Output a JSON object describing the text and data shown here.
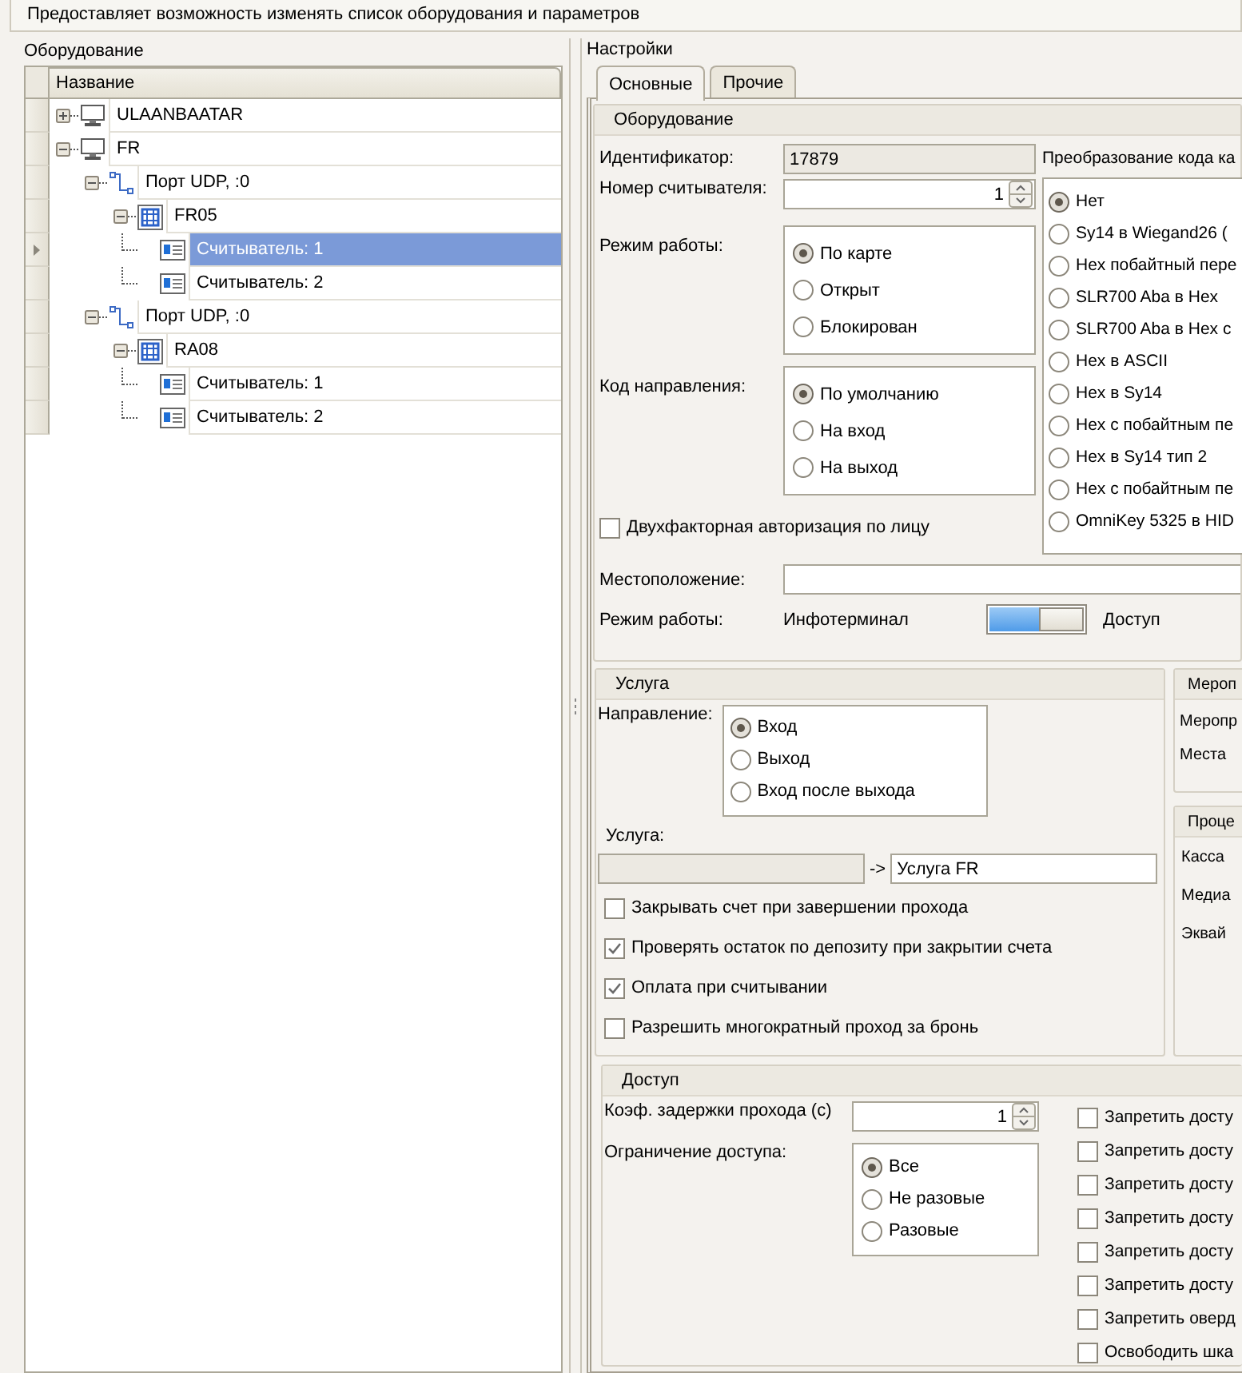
{
  "description": "Предоставляет возможность изменять список оборудования и параметров",
  "equipment": {
    "title": "Оборудование",
    "column": "Название",
    "tree": [
      {
        "label": "ULAANBAATAR",
        "kind": "computer",
        "expanded": false,
        "selected": false
      },
      {
        "label": "FR",
        "kind": "computer",
        "expanded": true,
        "selected": false,
        "children": [
          {
            "label": "Порт UDP, :0",
            "kind": "port",
            "expanded": true,
            "selected": false,
            "children": [
              {
                "label": "FR05",
                "kind": "controller",
                "expanded": true,
                "selected": false,
                "children": [
                  {
                    "label": "Считыватель: 1",
                    "kind": "reader",
                    "selected": true
                  },
                  {
                    "label": "Считыватель: 2",
                    "kind": "reader",
                    "selected": false
                  }
                ]
              }
            ]
          },
          {
            "label": "Порт UDP, :0",
            "kind": "port",
            "expanded": true,
            "selected": false,
            "children": [
              {
                "label": "RA08",
                "kind": "controller",
                "expanded": true,
                "selected": false,
                "children": [
                  {
                    "label": "Считыватель: 1",
                    "kind": "reader",
                    "selected": false
                  },
                  {
                    "label": "Считыватель: 2",
                    "kind": "reader",
                    "selected": false
                  }
                ]
              }
            ]
          }
        ]
      }
    ]
  },
  "settings": {
    "title": "Настройки",
    "tabs": [
      {
        "label": "Основные",
        "selected": true
      },
      {
        "label": "Прочие",
        "selected": false
      }
    ],
    "hardware": {
      "title": "Оборудование",
      "id_label": "Идентификатор:",
      "id_value": "17879",
      "reader_label": "Номер считывателя:",
      "reader_value": "1",
      "work_mode": {
        "label": "Режим работы:",
        "options": [
          {
            "label": "По карте",
            "selected": true
          },
          {
            "label": "Открыт",
            "selected": false
          },
          {
            "label": "Блокирован",
            "selected": false
          }
        ]
      },
      "direction_code": {
        "label": "Код направления:",
        "options": [
          {
            "label": "По умолчанию",
            "selected": true
          },
          {
            "label": "На вход",
            "selected": false
          },
          {
            "label": "На выход",
            "selected": false
          }
        ]
      },
      "two_factor": {
        "label": "Двухфакторная авторизация по лицу",
        "checked": false
      },
      "location_label": "Местоположение:",
      "mode": {
        "label": "Режим работы:",
        "left": "Инфотерминал",
        "right": "Доступ",
        "on": true
      },
      "code_conversion": {
        "title": "Преобразование кода ка",
        "options": [
          {
            "label": "Нет",
            "selected": true
          },
          {
            "label": "Sy14 в Wiegand26 (",
            "selected": false
          },
          {
            "label": "Hex побайтный пере",
            "selected": false
          },
          {
            "label": "SLR700 Aba в Hex",
            "selected": false
          },
          {
            "label": "SLR700 Aba в Hex с",
            "selected": false
          },
          {
            "label": "Hex в ASCII",
            "selected": false
          },
          {
            "label": "Hex в Sy14",
            "selected": false
          },
          {
            "label": "Hex с побайтным пе",
            "selected": false
          },
          {
            "label": "Hex в Sy14 тип 2",
            "selected": false
          },
          {
            "label": "Hex с побайтным пе",
            "selected": false
          },
          {
            "label": "OmniKey 5325 в HID",
            "selected": false
          }
        ]
      }
    },
    "service": {
      "title": "Услуга",
      "direction": {
        "label": "Направление:",
        "options": [
          {
            "label": "Вход",
            "selected": true
          },
          {
            "label": "Выход",
            "selected": false
          },
          {
            "label": "Вход после выхода",
            "selected": false
          }
        ]
      },
      "service_label": "Услуга:",
      "arrow": "->",
      "service_value": "Услуга FR",
      "checks": [
        {
          "label": "Закрывать счет при завершении прохода",
          "checked": false
        },
        {
          "label": "Проверять остаток по депозиту при закрытии счета",
          "checked": true
        },
        {
          "label": "Оплата при считывании",
          "checked": true
        },
        {
          "label": "Разрешить многократный проход за бронь",
          "checked": false
        }
      ]
    },
    "events": {
      "title": "Мероп",
      "labels": [
        "Меропр",
        "Места"
      ]
    },
    "processing": {
      "title": "Проце",
      "labels": [
        "Касса",
        "Медиа",
        "Эквай"
      ]
    },
    "access": {
      "title": "Доступ",
      "delay_label": "Коэф. задержки прохода (с)",
      "delay_value": "1",
      "restriction": {
        "label": "Ограничение доступа:",
        "options": [
          {
            "label": "Все",
            "selected": true
          },
          {
            "label": "Не разовые",
            "selected": false
          },
          {
            "label": "Разовые",
            "selected": false
          }
        ]
      },
      "checks": [
        {
          "label": "Запретить досту",
          "checked": false
        },
        {
          "label": "Запретить досту",
          "checked": false
        },
        {
          "label": "Запретить досту",
          "checked": false
        },
        {
          "label": "Запретить досту",
          "checked": false
        },
        {
          "label": "Запретить досту",
          "checked": false
        },
        {
          "label": "Запретить досту",
          "checked": false
        },
        {
          "label": "Запретить оверд",
          "checked": false
        },
        {
          "label": "Освободить шка",
          "checked": false
        }
      ]
    }
  }
}
